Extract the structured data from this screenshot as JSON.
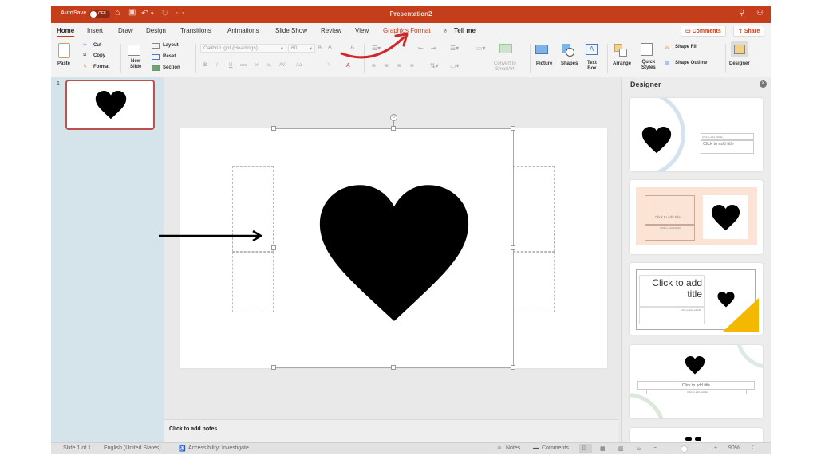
{
  "titlebar": {
    "autosave_label": "AutoSave",
    "autosave_state": "OFF",
    "title": "Presentation2",
    "icons": [
      "home-icon",
      "save-icon",
      "undo-icon",
      "redo-icon",
      "more-icon",
      "search-icon",
      "share-person-icon"
    ]
  },
  "tabs": [
    {
      "label": "Home",
      "active": true
    },
    {
      "label": "Insert"
    },
    {
      "label": "Draw"
    },
    {
      "label": "Design"
    },
    {
      "label": "Transitions"
    },
    {
      "label": "Animations"
    },
    {
      "label": "Slide Show"
    },
    {
      "label": "Review"
    },
    {
      "label": "View"
    },
    {
      "label": "Graphics Format",
      "contextual": true
    },
    {
      "label": "Tell me",
      "icon": "lightbulb-icon"
    }
  ],
  "top_buttons": {
    "comments": "Comments",
    "share": "Share"
  },
  "ribbon": {
    "clipboard": {
      "paste": "Paste",
      "cut": "Cut",
      "copy": "Copy",
      "format": "Format"
    },
    "slides": {
      "new_slide_line1": "New",
      "new_slide_line2": "Slide",
      "layout": "Layout",
      "reset": "Reset",
      "section": "Section"
    },
    "font": {
      "font_name": "Calibri Light (Headings)",
      "font_size": "60",
      "bold": "B",
      "italic": "I",
      "underline": "U",
      "strike": "abc",
      "superscript": "x²",
      "subscript": "x₂",
      "spacing": "AV",
      "case": "Aa"
    },
    "convert_smartart_line1": "Convert to",
    "convert_smartart_line2": "SmartArt",
    "insert": {
      "picture": "Picture",
      "shapes": "Shapes",
      "textbox_line1": "Text",
      "textbox_line2": "Box"
    },
    "arrange": "Arrange",
    "quick_styles_line1": "Quick",
    "quick_styles_line2": "Styles",
    "shape_fill": "Shape Fill",
    "shape_outline": "Shape Outline",
    "designer": "Designer"
  },
  "thumbnails": [
    {
      "number": "1",
      "content": "heart",
      "selected": true
    }
  ],
  "slide": {
    "content": "heart-graphic",
    "selected": true
  },
  "notes_placeholder": "Click to add notes",
  "designer": {
    "title": "Designer",
    "designs": [
      {
        "title_placeholder": "Click to add title",
        "subtitle_placeholder": "Click to add subtitle"
      },
      {
        "title_placeholder": "Click to add title",
        "subtitle_placeholder": "Click to add subtitle"
      },
      {
        "title_line1": "Click to add",
        "title_line2": "title",
        "subtitle_placeholder": "Click to add subtitle"
      },
      {
        "title_placeholder": "Click to add title",
        "subtitle_placeholder": "Click to add subtitle"
      }
    ]
  },
  "status": {
    "slide_count": "Slide 1 of 1",
    "language": "English (United States)",
    "accessibility": "Accessibility: Investigate",
    "notes": "Notes",
    "comments": "Comments",
    "zoom_level": "90%",
    "zoom_fraction": 0.45
  },
  "annotations": {
    "black_arrow": "points to graphic left edge",
    "red_arrow": "points to Graphics Format tab"
  },
  "colors": {
    "accent": "#c43e1c",
    "thumbnail_pane": "#d5e3ea",
    "design2_bg": "#fbe3d6",
    "design3_accent": "#f5b800"
  }
}
